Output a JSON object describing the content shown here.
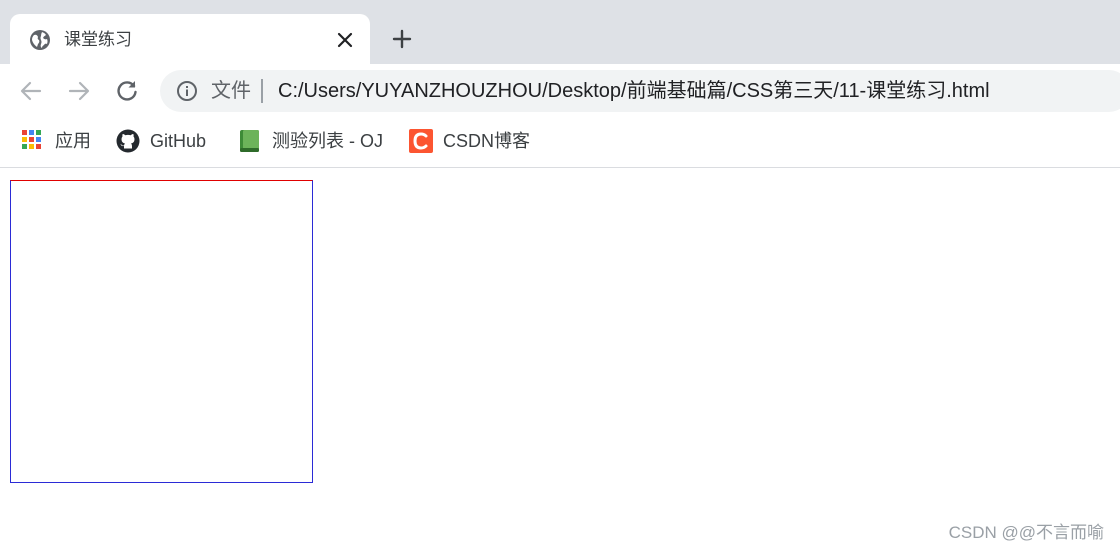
{
  "tab": {
    "title": "课堂练习",
    "favicon": "globe-icon",
    "close_icon": "close-icon"
  },
  "new_tab_icon": "plus-icon",
  "toolbar": {
    "back_icon": "arrow-left-icon",
    "forward_icon": "arrow-right-icon",
    "reload_icon": "reload-icon"
  },
  "omnibox": {
    "info_icon": "info-icon",
    "scheme_label": "文件",
    "url": "C:/Users/YUYANZHOUZHOU/Desktop/前端基础篇/CSS第三天/11-课堂练习.html"
  },
  "bookmarks": [
    {
      "label": "应用",
      "icon": "apps-grid-icon"
    },
    {
      "label": "GitHub",
      "icon": "github-icon"
    },
    {
      "label": "测验列表 - OJ",
      "icon": "book-icon"
    },
    {
      "label": "CSDN博客",
      "icon": "csdn-icon"
    }
  ],
  "page": {
    "box_border_top_color": "#e00000",
    "box_border_color": "#2b2bd6"
  },
  "watermark": "CSDN @@不言而喻",
  "colors": {
    "tabstrip_bg": "#dee1e6",
    "omnibox_bg": "#f1f3f4",
    "csdn_brand": "#fc5531"
  }
}
